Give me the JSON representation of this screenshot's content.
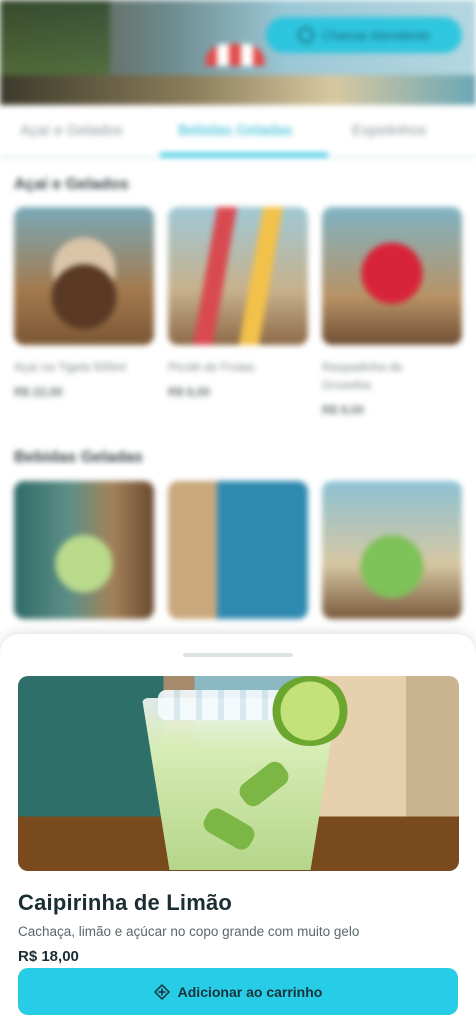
{
  "header": {
    "action_label": "Chamar Atendente"
  },
  "tabs": [
    {
      "label": "Açaí e Gelados"
    },
    {
      "label": "Bebidas Geladas"
    },
    {
      "label": "Espetinhos"
    }
  ],
  "sections": [
    {
      "title": "Açaí e Gelados",
      "items": [
        {
          "name": "Açaí na Tigela 500ml",
          "price": "R$ 22,00",
          "icon": "acai-bowl"
        },
        {
          "name": "Picolé de Frutas",
          "price": "R$ 8,00",
          "icon": "popsicles"
        },
        {
          "name": "Raspadinha de Groselha",
          "price": "R$ 9,00",
          "icon": "slushie"
        }
      ]
    },
    {
      "title": "Bebidas Geladas",
      "items": [
        {
          "icon": "caipirinha"
        },
        {
          "icon": "cold-drinks"
        },
        {
          "icon": "coconut"
        }
      ]
    }
  ],
  "sheet": {
    "product": {
      "title": "Caipirinha de Limão",
      "description": "Cachaça, limão e açúcar no copo grande com muito gelo",
      "price": "R$ 18,00"
    },
    "add_button_label": "Adicionar ao carrinho",
    "add_icon": "plus-circle-icon"
  },
  "colors": {
    "accent": "#27cde6",
    "title": "#1b2e33",
    "muted": "#5b666a"
  }
}
